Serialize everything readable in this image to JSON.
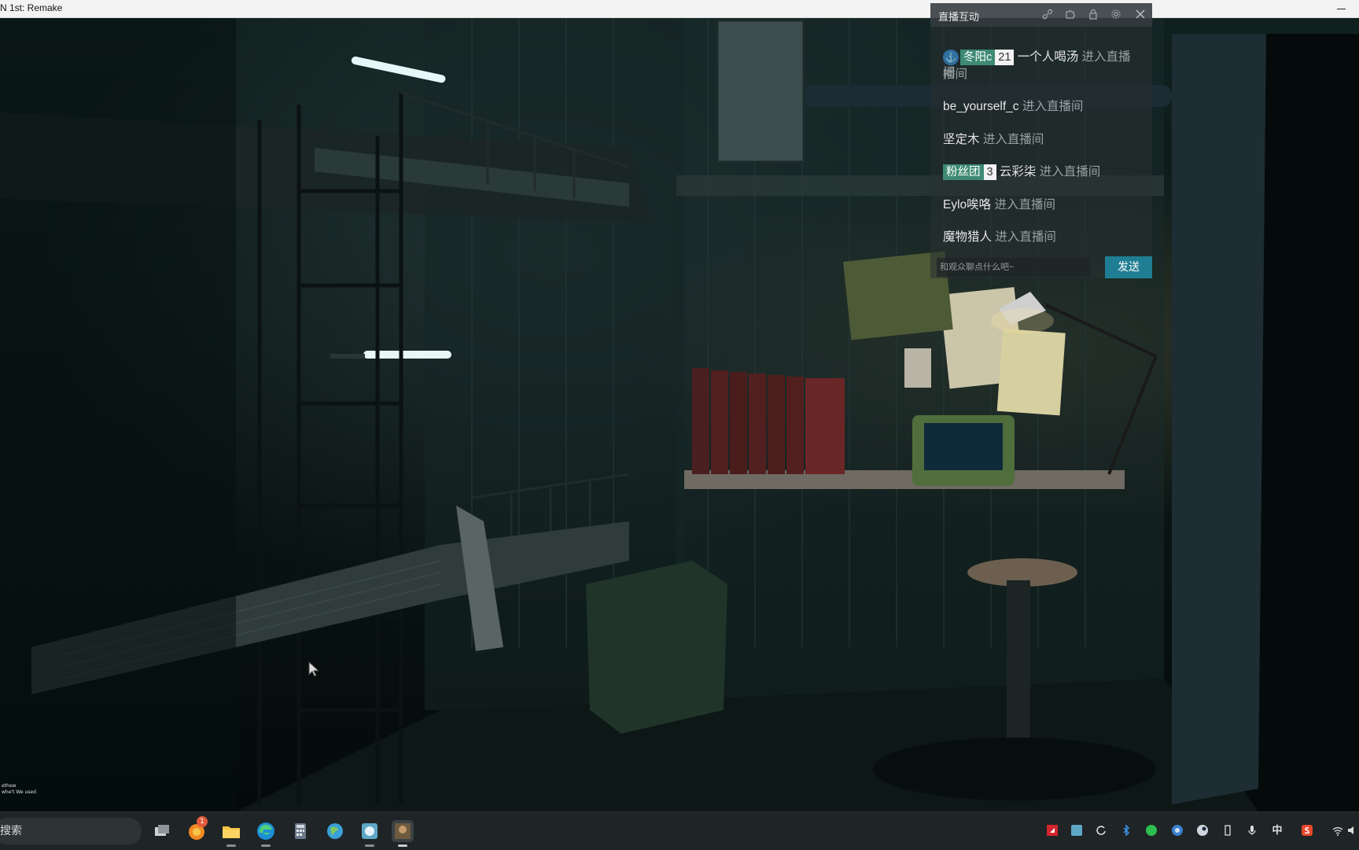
{
  "window": {
    "title": "N 1st: Remake"
  },
  "live_chat": {
    "title": "直播互动",
    "header_icons": [
      "link-icon",
      "puzzle-icon",
      "lock-icon",
      "settings-icon",
      "close-icon"
    ],
    "messages": [
      {
        "name": "一个人喝汤",
        "action": "进入直播间",
        "badge_name": "冬阳c",
        "badge_level": "21",
        "badge_icon": "anchor-icon",
        "continued_action": "播间"
      },
      {
        "name": "be_yourself_c",
        "action": "进入直播间"
      },
      {
        "name": "坚定木",
        "action": "进入直播间"
      },
      {
        "name": "云彩柒",
        "action": "进入直播间",
        "badge_name": "粉丝团",
        "badge_level": "3"
      },
      {
        "name": "Eylo唉咯",
        "action": "进入直播间"
      },
      {
        "name": "魔物猎人",
        "action": "进入直播间"
      }
    ],
    "input_placeholder": "和观众聊点什么吧~",
    "send_label": "发送"
  },
  "overlay": {
    "small_text_1": "ethew",
    "small_text_2": "whe't We used"
  },
  "taskbar": {
    "search_label": "搜索",
    "notification_count": "1",
    "ime_label": "中"
  }
}
